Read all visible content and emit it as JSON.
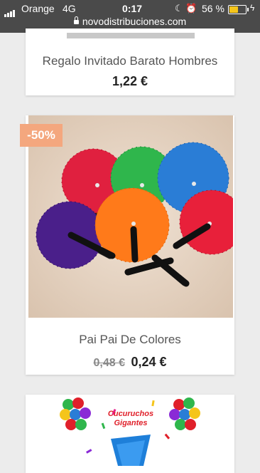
{
  "status_bar": {
    "carrier": "Orange",
    "network": "4G",
    "time": "0:17",
    "battery_percent": "56 %",
    "battery_level": 0.56,
    "url": "novodistribuciones.com",
    "icons": [
      "signal-icon",
      "moon-icon",
      "alarm-icon",
      "battery-icon",
      "charging-icon",
      "lock-icon"
    ]
  },
  "products": [
    {
      "name": "Regalo Invitado Barato Hombres",
      "price": "1,22 €"
    },
    {
      "name": "Pai Pai De Colores",
      "discount_badge": "-50%",
      "old_price": "0,48 €",
      "price": "0,24 €",
      "fan_colors": [
        "#e81d45",
        "#2fb64c",
        "#2a7dd6",
        "#4a1f8a",
        "#ff7a1a",
        "#e8203a"
      ]
    },
    {
      "banner_text": "Cucuruchos Gigantes",
      "banner_color": "#e0202a"
    }
  ]
}
